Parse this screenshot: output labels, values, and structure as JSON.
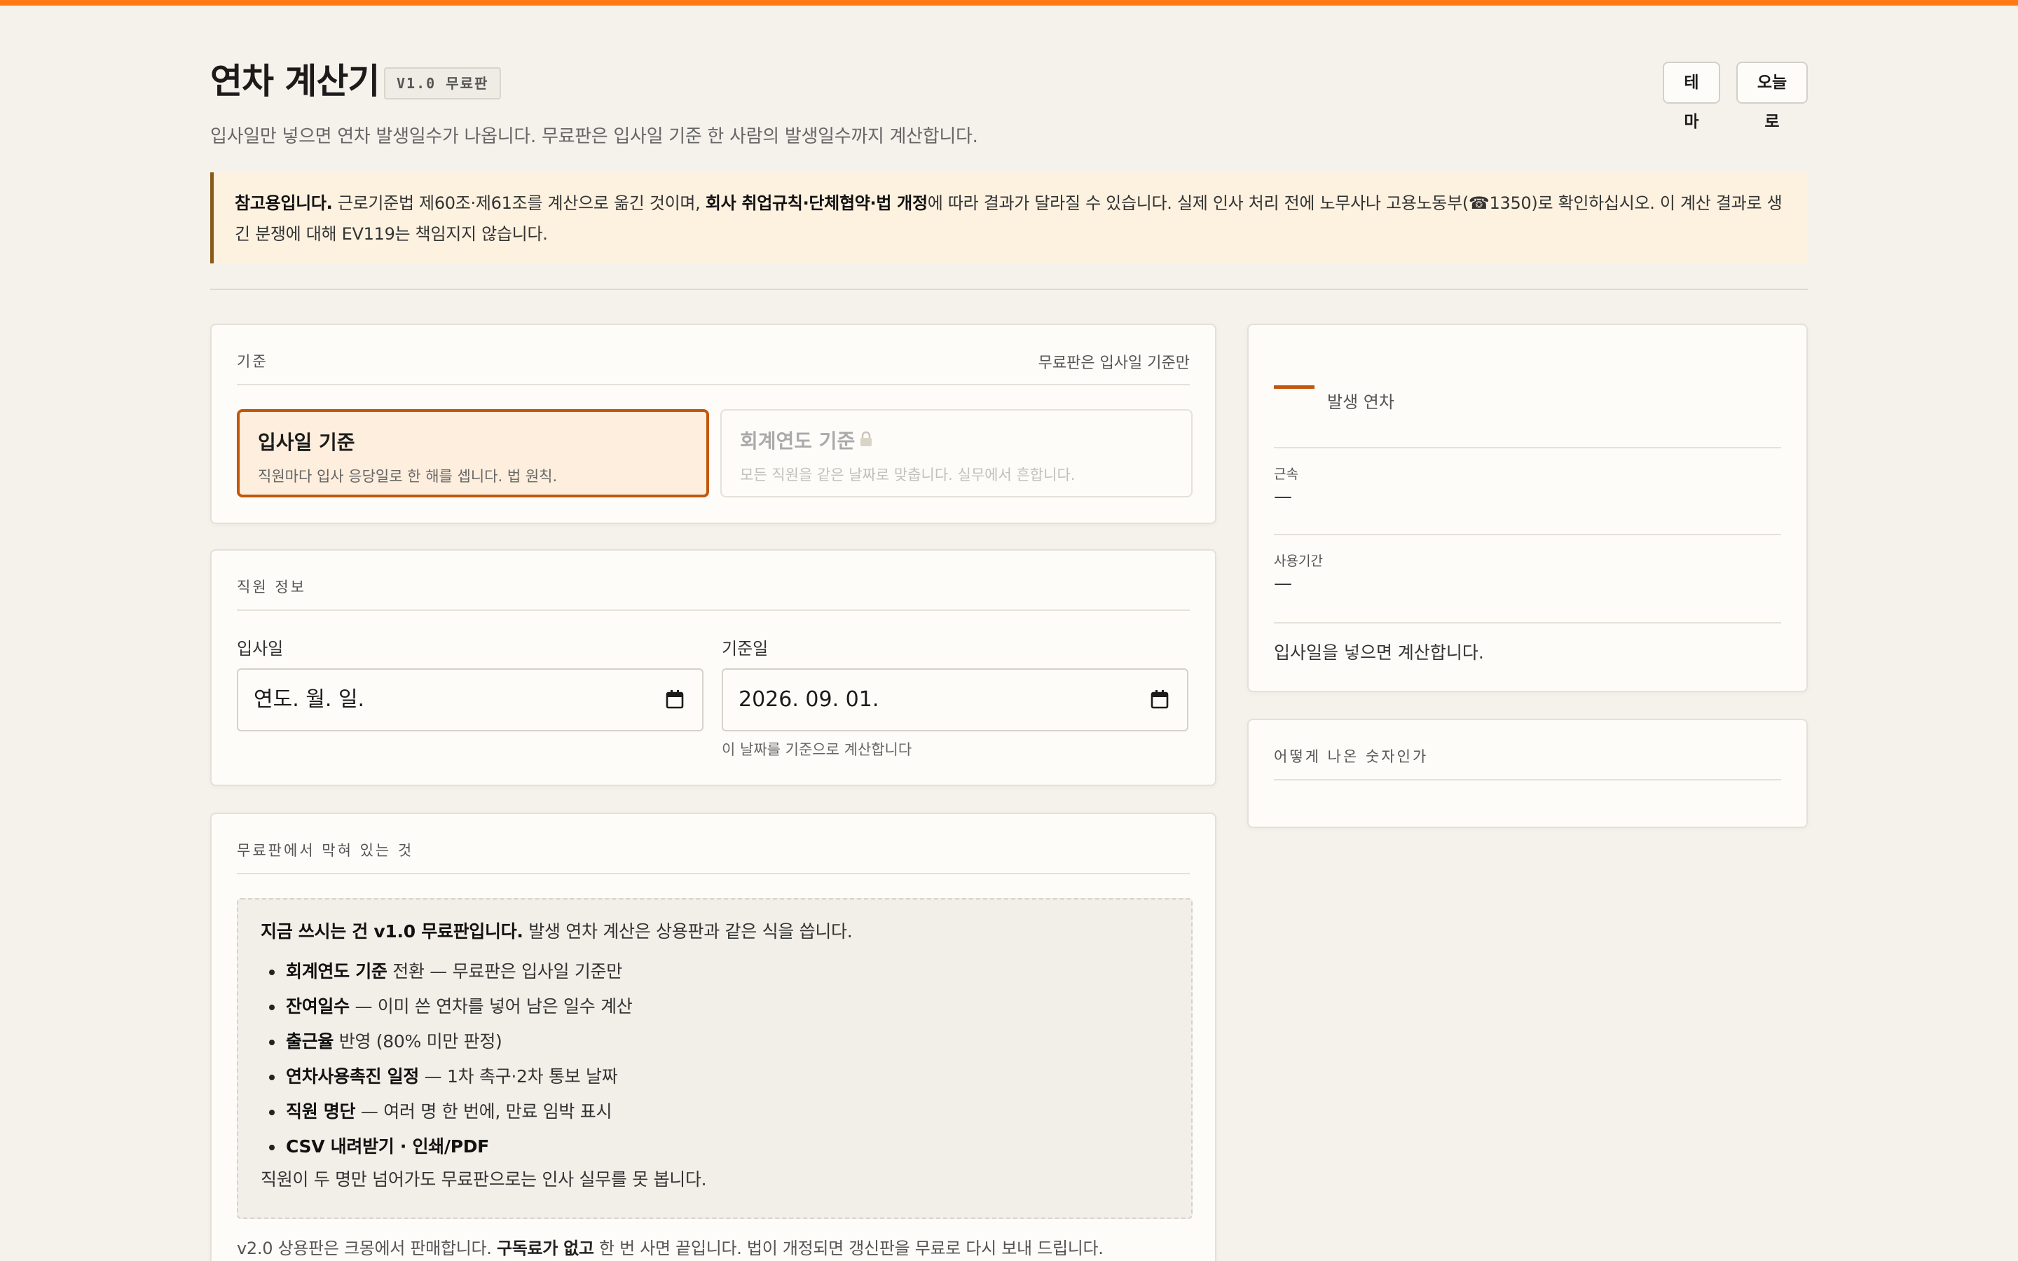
{
  "header": {
    "title": "연차 계산기",
    "version_badge": "V1.0 무료판",
    "theme_button": "테마",
    "today_button": "오늘로",
    "subtitle": "입사일만 넣으면 연차 발생일수가 나옵니다. 무료판은 입사일 기준 한 사람의 발생일수까지 계산합니다."
  },
  "notice": {
    "lead": "참고용입니다.",
    "text1": " 근로기준법 제60조·제61조를 계산으로 옮긴 것이며, ",
    "bold": "회사 취업규칙·단체협약·법 개정",
    "text2": "에 따라 결과가 달라질 수 있습니다. 실제 인사 처리 전에 노무사나 고용노동부(☎1350)로 확인하십시오. 이 계산 결과로 생긴 분쟁에 대해 EV119는 책임지지 않습니다."
  },
  "basis": {
    "heading": "기준",
    "note": "무료판은 입사일 기준만",
    "option_a": {
      "title": "입사일 기준",
      "desc": "직원마다 입사 응당일로 한 해를 셉니다. 법 원칙."
    },
    "option_b": {
      "title": "회계연도 기준",
      "desc": "모든 직원을 같은 날짜로 맞춥니다. 실무에서 흔합니다."
    }
  },
  "employee": {
    "heading": "직원 정보",
    "hire_label": "입사일",
    "hire_value": "연도. 월. 일.",
    "base_label": "기준일",
    "base_value": "2026. 09. 01.",
    "base_hint": "이 날짜를 기준으로 계산합니다"
  },
  "free": {
    "heading": "무료판에서 막혀 있는 것",
    "intro_bold": "지금 쓰시는 건 v1.0 무료판입니다.",
    "intro_rest": " 발생 연차 계산은 상용판과 같은 식을 씁니다.",
    "items": [
      {
        "bold": "회계연도 기준",
        "rest": " 전환 — 무료판은 입사일 기준만"
      },
      {
        "bold": "잔여일수",
        "rest": " — 이미 쓴 연차를 넣어 남은 일수 계산"
      },
      {
        "bold": "출근율",
        "rest": " 반영 (80% 미만 판정)"
      },
      {
        "bold": "연차사용촉진 일정",
        "rest": " — 1차 촉구·2차 통보 날짜"
      },
      {
        "bold": "직원 명단",
        "rest": " — 여러 명 한 번에, 만료 임박 표시"
      },
      {
        "bold": "CSV 내려받기 · 인쇄/PDF",
        "rest": ""
      }
    ],
    "footer": "직원이 두 명만 넘어가도 무료판으로는 인사 실무를 못 봅니다.",
    "note_pre": "v2.0 상용판은 크몽에서 판매합니다. ",
    "note_bold": "구독료가 없고",
    "note_post": " 한 번 사면 끝입니다. 법이 개정되면 갱신판을 무료로 다시 보내 드립니다."
  },
  "result": {
    "title": "발생 연차",
    "tenure_label": "근속",
    "tenure_value": "—",
    "period_label": "사용기간",
    "period_value": "—",
    "message": "입사일을 넣으면 계산합니다."
  },
  "how": {
    "heading": "어떻게 나온 숫자인가"
  },
  "colors": {
    "accent": "#ff7a13",
    "selected_border": "#c2570c",
    "notice_bg": "#fdf1e0"
  }
}
